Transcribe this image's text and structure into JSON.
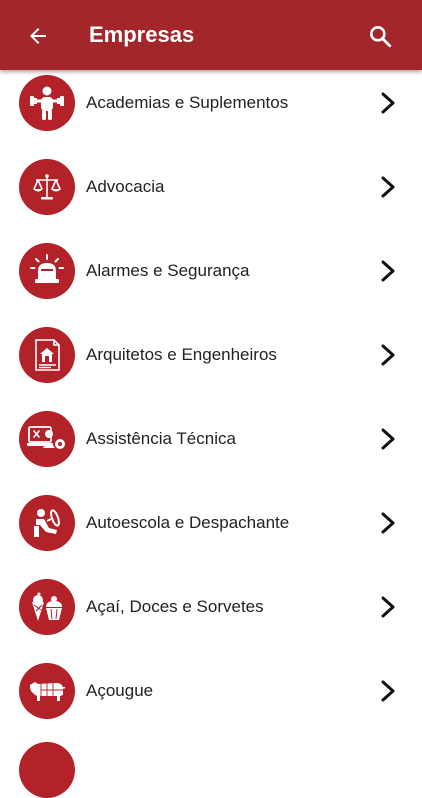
{
  "header": {
    "title": "Empresas",
    "back_icon": "arrow-left-icon",
    "search_icon": "search-icon",
    "background": "#a3262b"
  },
  "accent_color": "#b32129",
  "categories": [
    {
      "label": "Academias e Suplementos",
      "icon": "weightlifter-icon"
    },
    {
      "label": "Advocacia",
      "icon": "scales-of-justice-icon"
    },
    {
      "label": "Alarmes e Segurança",
      "icon": "siren-alarm-icon"
    },
    {
      "label": "Arquitetos e Engenheiros",
      "icon": "blueprint-house-icon"
    },
    {
      "label": "Assistência Técnica",
      "icon": "computer-repair-icon"
    },
    {
      "label": "Autoescola e Despachante",
      "icon": "driver-steering-wheel-icon"
    },
    {
      "label": "Açaí, Doces e Sorvetes",
      "icon": "ice-cream-cupcake-icon"
    },
    {
      "label": "Açougue",
      "icon": "bull-cuts-icon"
    }
  ]
}
